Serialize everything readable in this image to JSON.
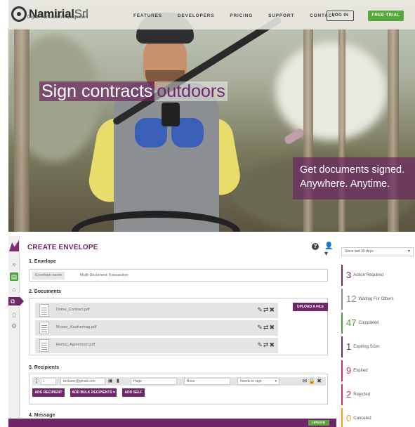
{
  "brand": {
    "name_bold": "Namirial",
    "name_light": "Srl",
    "subtitle": "Digital Transaction Management"
  },
  "nav": {
    "links": [
      "FEATURES",
      "DEVELOPERS",
      "PRICING",
      "SUPPORT",
      "CONTACT"
    ],
    "login": "LOG IN",
    "trial": "FREE TRIAL"
  },
  "hero": {
    "headline_1": "Sign contracts",
    "headline_2": "outdoors",
    "tagline_1": "Get documents signed.",
    "tagline_2": "Anywhere. Anytime."
  },
  "app": {
    "title": "CREATE ENVELOPE",
    "section_envelope": "1. Envelope",
    "envelope_label": "Envelope name",
    "envelope_value": "Multi-Document Transaction",
    "section_documents": "2. Documents",
    "documents": [
      "Dome_Contract.pdf",
      "Muster_Kaufvertrag.pdf",
      "Rental_Agreement.pdf"
    ],
    "upload_button": "UPLOAD A FILE",
    "section_recipients": "3. Recipients",
    "recipient": {
      "order": "1",
      "email": "testuser@gmail.com",
      "first_name": "Hugo",
      "last_name": "Boss",
      "action": "Needs to sign"
    },
    "add_recipient": "ADD RECIPIENT",
    "add_bulk": "ADD BULK RECIPIENTS ▾",
    "add_self": "ADD SELF",
    "section_message": "4. Message",
    "update_button": "UPDATE"
  },
  "status": {
    "range": "Since last 30 days",
    "items": [
      {
        "count": "3",
        "label": "Action Required",
        "color": "#6f2668"
      },
      {
        "count": "12",
        "label": "Waiting For Others",
        "color": "#888888"
      },
      {
        "count": "47",
        "label": "Completed",
        "color": "#4c9c3c"
      },
      {
        "count": "1",
        "label": "Expiring Soon",
        "color": "#6f2668"
      },
      {
        "count": "9",
        "label": "Expired",
        "color": "#c0306a"
      },
      {
        "count": "2",
        "label": "Rejected",
        "color": "#c0306a"
      },
      {
        "count": "0",
        "label": "Canceled",
        "color": "#e8a317"
      }
    ]
  }
}
